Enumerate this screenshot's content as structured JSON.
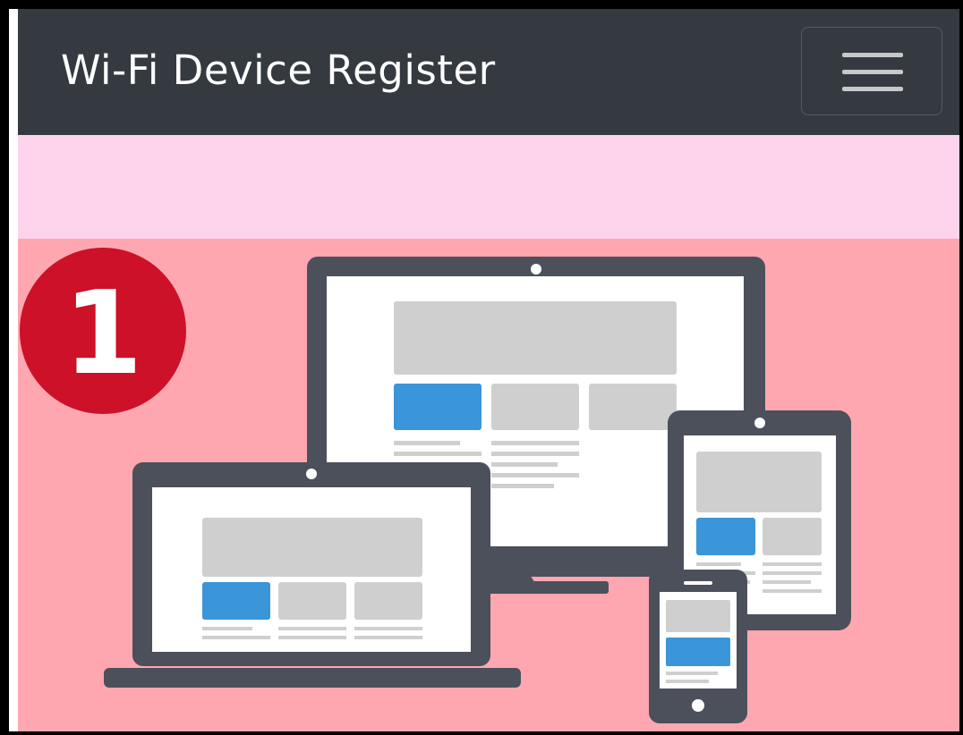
{
  "navbar": {
    "brand": "Wi-Fi Device Register",
    "menu_icon": "hamburger-menu-icon"
  },
  "hero": {
    "step_number": "1",
    "illustration": "multi-device-responsive-icon"
  },
  "colors": {
    "navbar_bg": "#343a40",
    "banner_bg": "#fed4ec",
    "hero_bg": "#fea7b1",
    "badge_red": "#cc1128",
    "device_frame": "#4b505b",
    "accent_blue": "#3a95d9"
  }
}
